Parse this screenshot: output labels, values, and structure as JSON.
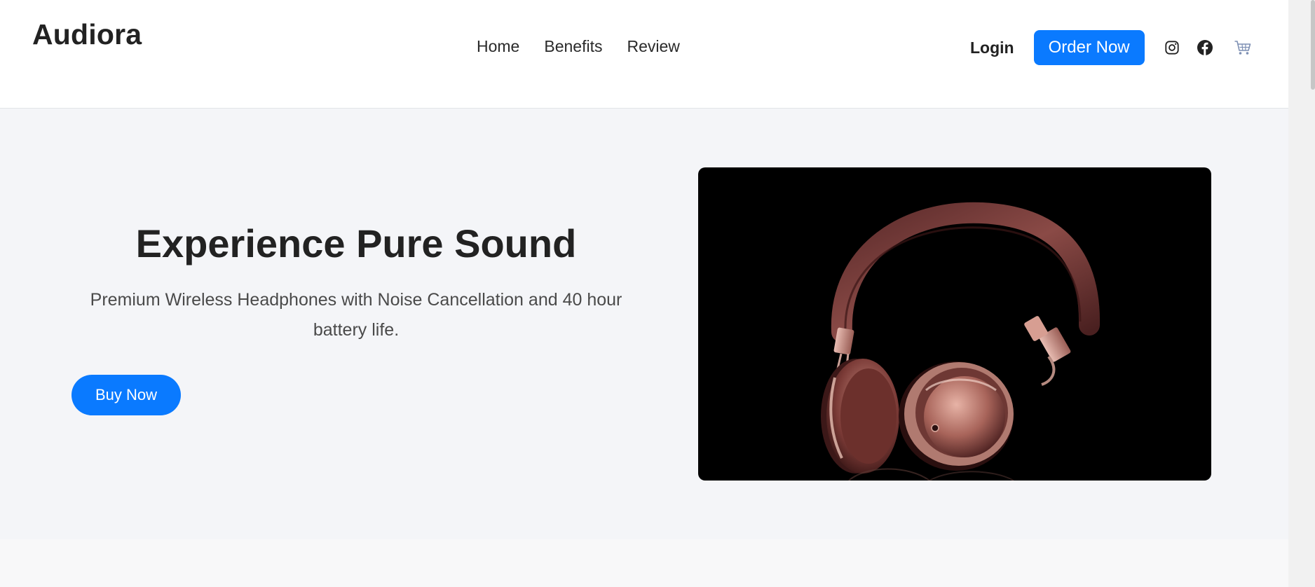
{
  "header": {
    "brand": "Audiora",
    "nav": [
      {
        "label": "Home"
      },
      {
        "label": "Benefits"
      },
      {
        "label": "Review"
      }
    ],
    "login_label": "Login",
    "order_label": "Order Now",
    "icons": [
      "instagram-icon",
      "facebook-icon",
      "cart-icon"
    ]
  },
  "hero": {
    "title": "Experience Pure Sound",
    "subtitle": "Premium Wireless Headphones with Noise Cancellation and 40 hour battery life.",
    "cta_label": "Buy Now",
    "image_subject": "rose-gold headphones on black background"
  },
  "colors": {
    "accent": "#0a7aff",
    "text_dark": "#222222",
    "hero_bg": "#f4f5f8",
    "image_bg": "#000000",
    "headphone_band": "#6e3434",
    "headphone_metal": "#b98077"
  }
}
